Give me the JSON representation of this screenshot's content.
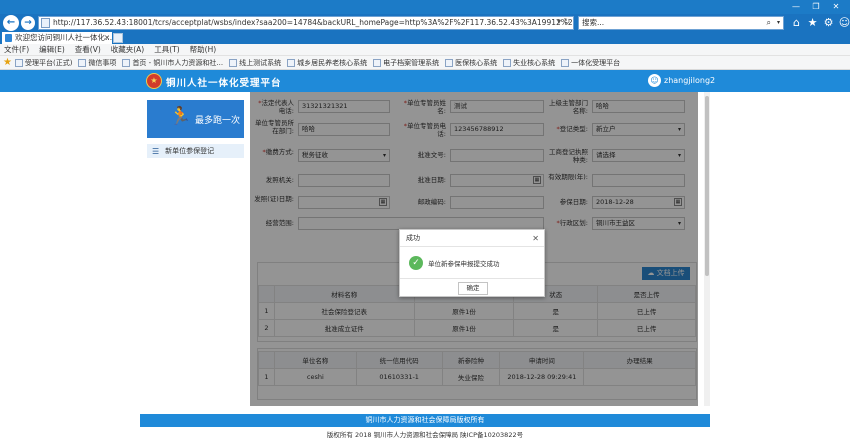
{
  "browser": {
    "window_controls": [
      "—",
      "❐",
      "✕"
    ],
    "nav_back": "←",
    "nav_forward": "→",
    "url": "http://117.36.52.43:18001/tcrs/acceptplat/wsbs/index?saa200=14784&backURL_homePage=http%3A%2F%2F117.36.52.43%3A19912%2F&sbkFlag=1&u",
    "url_controls": "▾ ↻",
    "search_placeholder": "搜索...",
    "search_icon": "⌕",
    "search_dropdown": "▾",
    "nav_icons": [
      "⌂",
      "★",
      "⚙",
      "☺"
    ],
    "tab_title": "欢迎您访问铜川人社一体化...",
    "tab_close": "✕"
  },
  "menu": [
    "文件(F)",
    "编辑(E)",
    "查看(V)",
    "收藏夹(A)",
    "工具(T)",
    "帮助(H)"
  ],
  "favorites": [
    "受理平台(正式)",
    "微信事项",
    "首页 - 铜川市人力资源和社...",
    "线上测试系统",
    "城乡居民养老核心系统",
    "电子档案管理系统",
    "医保核心系统",
    "失业核心系统",
    "一体化受理平台"
  ],
  "site": {
    "title": "铜川人社一体化受理平台",
    "emblem": "★",
    "username": "zhangjilong2",
    "avatar_glyph": "☺"
  },
  "sidebar": {
    "banner_text": "最多跑一次",
    "banner_glyph": "🏃",
    "item_icon": "☰",
    "item": "新单位参保登记"
  },
  "form": {
    "row1": {
      "l1": "法定代表人电话:",
      "v1": "31321321321",
      "l2": "单位专管员姓名:",
      "v2": "测试",
      "l3": "上级主管部门名称:",
      "v3": "哈哈"
    },
    "row2": {
      "l1": "单位专管员所在部门:",
      "v1": "哈哈",
      "l2": "单位专管员电话:",
      "v2": "123456788912",
      "l3": "登记类型:",
      "v3": "新立户"
    },
    "row3": {
      "l1": "缴费方式:",
      "v1": "税务征收",
      "l2": "批准文号:",
      "v2": "",
      "l3": "工商登记执照种类:",
      "v3": "请选择"
    },
    "row4": {
      "l1": "发照机关:",
      "v1": "",
      "l2": "批准日期:",
      "v2": "",
      "l3": "有效期限(年):",
      "v3": ""
    },
    "row5": {
      "l1": "发照(证)日期:",
      "v1": "",
      "l2": "邮政编码:",
      "v2": "",
      "l3": "参保日期:",
      "v3": "2018-12-28"
    },
    "row6": {
      "l1": "经营范围:",
      "v1": "",
      "l3": "行政区划:",
      "v3": "铜川市王益区"
    },
    "dropdown_glyph": "▾",
    "calendar_glyph": "▦"
  },
  "materials": {
    "upload_label": "☁ 文档上传",
    "headers": [
      "",
      "材料名称",
      "",
      "状态",
      "是否上传"
    ],
    "rows": [
      [
        "1",
        "社会保险登记表",
        "原件1份",
        "是",
        "已上传"
      ],
      [
        "2",
        "批准成立证件",
        "原件1份",
        "是",
        "已上传"
      ]
    ]
  },
  "applications": {
    "headers": [
      "",
      "单位名称",
      "统一信用代码",
      "新参险种",
      "申请时间",
      "办理结果"
    ],
    "rows": [
      [
        "1",
        "ceshi",
        "01610331-1",
        "失业保险",
        "2018-12-28 09:29:41",
        ""
      ]
    ]
  },
  "footer": {
    "line1": "铜川市人力资源和社会保障局版权所有",
    "line2": "版权所有 2018 铜川市人力资源和社会保障局 陕ICP备10203822号"
  },
  "modal": {
    "title": "成功",
    "close": "✕",
    "check": "✓",
    "message": "单位新参保申报提交成功",
    "ok": "确定"
  }
}
